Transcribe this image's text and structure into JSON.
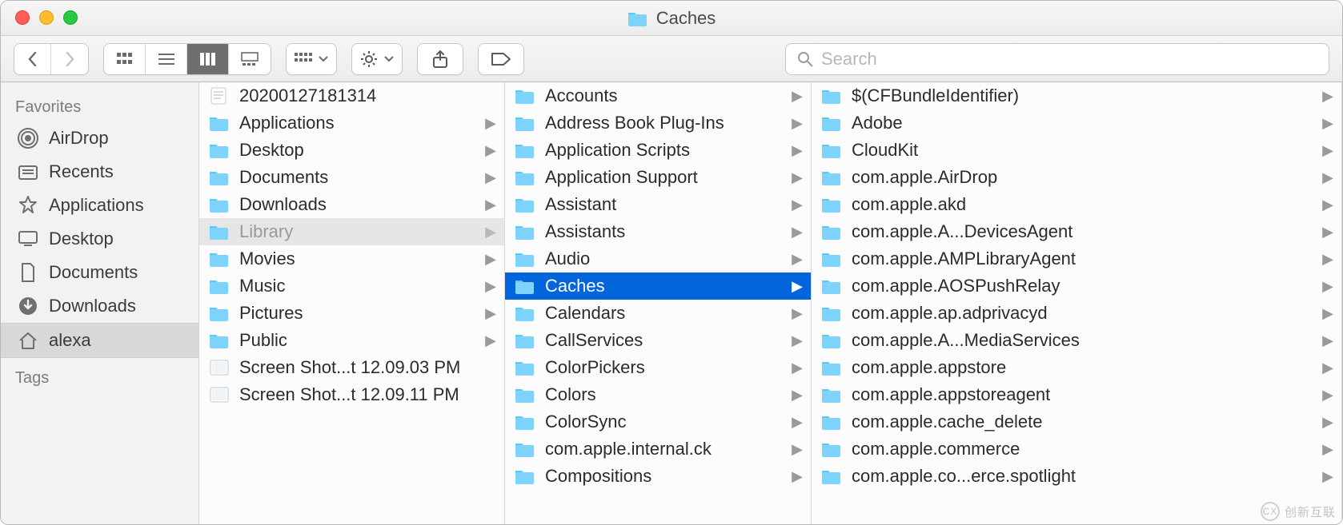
{
  "window": {
    "title": "Caches"
  },
  "search": {
    "placeholder": "Search",
    "value": ""
  },
  "sidebar": {
    "sections": [
      {
        "label": "Favorites",
        "items": [
          {
            "icon": "airdrop",
            "label": "AirDrop"
          },
          {
            "icon": "recents",
            "label": "Recents"
          },
          {
            "icon": "apps",
            "label": "Applications"
          },
          {
            "icon": "desktop",
            "label": "Desktop"
          },
          {
            "icon": "docs",
            "label": "Documents"
          },
          {
            "icon": "downloads",
            "label": "Downloads"
          },
          {
            "icon": "home",
            "label": "alexa",
            "selected": true
          }
        ]
      },
      {
        "label": "Tags",
        "items": []
      }
    ]
  },
  "columns": [
    {
      "items": [
        {
          "type": "document",
          "name": "20200127181314"
        },
        {
          "type": "folder",
          "name": "Applications",
          "hasChildren": true
        },
        {
          "type": "folder",
          "name": "Desktop",
          "hasChildren": true
        },
        {
          "type": "folder",
          "name": "Documents",
          "hasChildren": true
        },
        {
          "type": "folder",
          "name": "Downloads",
          "hasChildren": true
        },
        {
          "type": "folder",
          "name": "Library",
          "hasChildren": true,
          "state": "path"
        },
        {
          "type": "folder",
          "name": "Movies",
          "hasChildren": true
        },
        {
          "type": "folder",
          "name": "Music",
          "hasChildren": true
        },
        {
          "type": "folder",
          "name": "Pictures",
          "hasChildren": true
        },
        {
          "type": "folder",
          "name": "Public",
          "hasChildren": true
        },
        {
          "type": "image",
          "name": "Screen Shot...t 12.09.03 PM"
        },
        {
          "type": "image",
          "name": "Screen Shot...t 12.09.11 PM"
        }
      ]
    },
    {
      "items": [
        {
          "type": "folder",
          "name": "Accounts",
          "hasChildren": true
        },
        {
          "type": "folder",
          "name": "Address Book Plug-Ins",
          "hasChildren": true
        },
        {
          "type": "folder",
          "name": "Application Scripts",
          "hasChildren": true
        },
        {
          "type": "folder",
          "name": "Application Support",
          "hasChildren": true
        },
        {
          "type": "folder",
          "name": "Assistant",
          "hasChildren": true
        },
        {
          "type": "folder",
          "name": "Assistants",
          "hasChildren": true
        },
        {
          "type": "folder",
          "name": "Audio",
          "hasChildren": true
        },
        {
          "type": "folder",
          "name": "Caches",
          "hasChildren": true,
          "state": "selected"
        },
        {
          "type": "folder",
          "name": "Calendars",
          "hasChildren": true
        },
        {
          "type": "folder",
          "name": "CallServices",
          "hasChildren": true
        },
        {
          "type": "folder",
          "name": "ColorPickers",
          "hasChildren": true
        },
        {
          "type": "folder",
          "name": "Colors",
          "hasChildren": true
        },
        {
          "type": "folder",
          "name": "ColorSync",
          "hasChildren": true
        },
        {
          "type": "folder",
          "name": "com.apple.internal.ck",
          "hasChildren": true
        },
        {
          "type": "folder",
          "name": "Compositions",
          "hasChildren": true
        }
      ]
    },
    {
      "items": [
        {
          "type": "folder",
          "name": "$(CFBundleIdentifier)",
          "hasChildren": true
        },
        {
          "type": "folder",
          "name": "Adobe",
          "hasChildren": true
        },
        {
          "type": "folder",
          "name": "CloudKit",
          "hasChildren": true
        },
        {
          "type": "folder",
          "name": "com.apple.AirDrop",
          "hasChildren": true
        },
        {
          "type": "folder",
          "name": "com.apple.akd",
          "hasChildren": true
        },
        {
          "type": "folder",
          "name": "com.apple.A...DevicesAgent",
          "hasChildren": true
        },
        {
          "type": "folder",
          "name": "com.apple.AMPLibraryAgent",
          "hasChildren": true
        },
        {
          "type": "folder",
          "name": "com.apple.AOSPushRelay",
          "hasChildren": true
        },
        {
          "type": "folder",
          "name": "com.apple.ap.adprivacyd",
          "hasChildren": true
        },
        {
          "type": "folder",
          "name": "com.apple.A...MediaServices",
          "hasChildren": true
        },
        {
          "type": "folder",
          "name": "com.apple.appstore",
          "hasChildren": true
        },
        {
          "type": "folder",
          "name": "com.apple.appstoreagent",
          "hasChildren": true
        },
        {
          "type": "folder",
          "name": "com.apple.cache_delete",
          "hasChildren": true
        },
        {
          "type": "folder",
          "name": "com.apple.commerce",
          "hasChildren": true
        },
        {
          "type": "folder",
          "name": "com.apple.co...erce.spotlight",
          "hasChildren": true
        }
      ]
    }
  ],
  "watermark": {
    "text": "创新互联"
  }
}
